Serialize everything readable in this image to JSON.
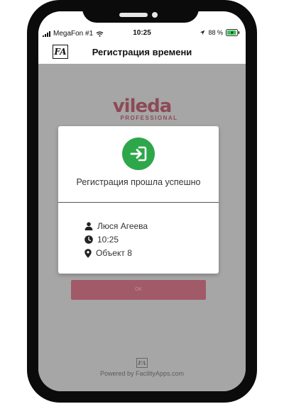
{
  "status_bar": {
    "carrier": "MegaFon #1",
    "time": "10:25",
    "battery": "88 %"
  },
  "nav": {
    "logo_text": "FA",
    "title": "Регистрация времени"
  },
  "brand": {
    "name": "vileda",
    "subtitle": "PROFESSIONAL",
    "color": "#8d4a56"
  },
  "background_button": {
    "label": "OK"
  },
  "footer": {
    "logo_text": "FA",
    "text": "Powered by FacilityApps.com"
  },
  "modal": {
    "icon": "sign-in-icon",
    "accent_color": "#2ea74a",
    "message": "Регистрация прошла успешно",
    "details": [
      {
        "icon": "user-icon",
        "text": "Люся Агеева"
      },
      {
        "icon": "clock-icon",
        "text": "10:25"
      },
      {
        "icon": "location-pin-icon",
        "text": "Объект 8"
      }
    ]
  }
}
